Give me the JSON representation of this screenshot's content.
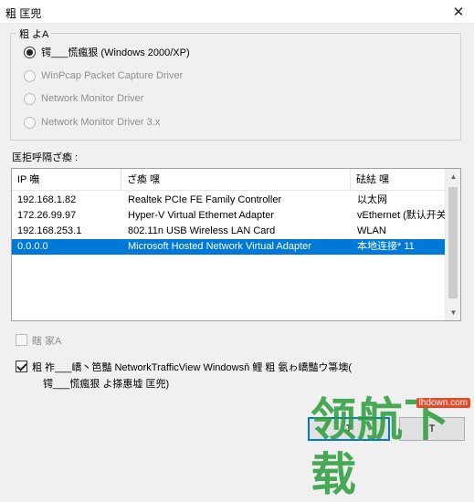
{
  "window": {
    "title": "粗  匡兜",
    "close_glyph": "✕"
  },
  "capture_group": {
    "legend": "粗  よA",
    "options": [
      {
        "label": "锷___慌瘋狠 (Windows 2000/XP)",
        "checked": true,
        "enabled": true
      },
      {
        "label": "WinPcap Packet Capture Driver",
        "checked": false,
        "enabled": false
      },
      {
        "label": "Network Monitor Driver",
        "checked": false,
        "enabled": false
      },
      {
        "label": "Network Monitor Driver 3.x",
        "checked": false,
        "enabled": false
      }
    ]
  },
  "adapters": {
    "label": "匡拒呼隔ざ瘓  :",
    "columns": [
      "IP 嘸",
      "ざ瘓      嘿",
      "砝紶    嘿"
    ],
    "rows": [
      {
        "ip": "192.168.1.82",
        "name": "Realtek PCIe FE Family Controller",
        "conn": "以太网",
        "selected": false
      },
      {
        "ip": "172.26.99.97",
        "name": "Hyper-V Virtual Ethernet Adapter",
        "conn": "vEthernet (默认开关)",
        "selected": false
      },
      {
        "ip": "192.168.253.1",
        "name": "802.11n USB Wireless LAN Card",
        "conn": "WLAN",
        "selected": false
      },
      {
        "ip": "0.0.0.0",
        "name": "Microsoft Hosted Network Virtual Adapter",
        "conn": "本地连接* 11",
        "selected": true
      }
    ]
  },
  "options": {
    "opt1_label": "瞎    家A",
    "opt2_line1": "粗  祚___嶠丶笆豔 NetworkTrafficView         Windowsň    鲤      粗  氨ゎ嶠豔ウ箒墺(",
    "opt2_line2": "锷___慌瘋狠   よ搽惠墟   匡兜)"
  },
  "buttons": {
    "ok": "T",
    "cancel": "T"
  },
  "watermark": {
    "text": "领航下载",
    "url": "lhdown.com"
  },
  "colors": {
    "accent": "#0078d7",
    "watermark_green": "#2a9d3a"
  }
}
